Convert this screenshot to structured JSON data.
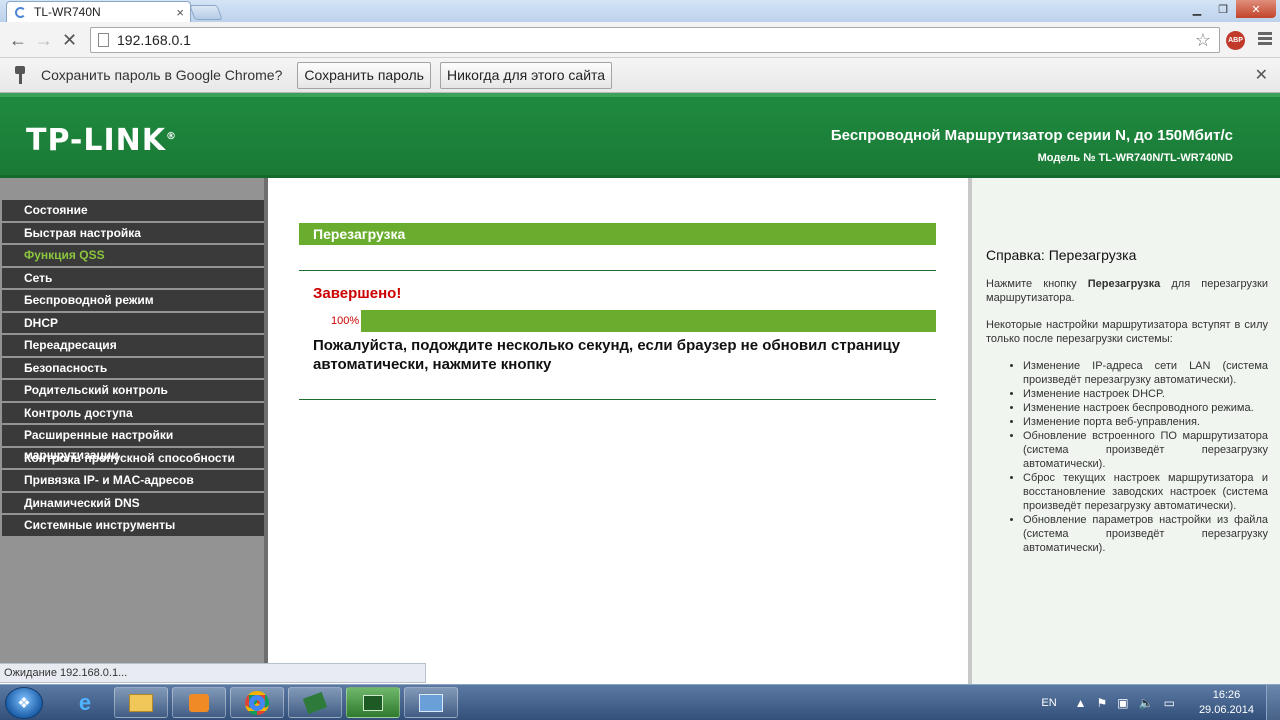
{
  "browser": {
    "tab_title": "TL-WR740N",
    "address": "192.168.0.1",
    "window_controls": {
      "minimize": "▁",
      "maximize": "❐",
      "close": "✕"
    }
  },
  "infobar": {
    "message": "Сохранить пароль в Google Chrome?",
    "save_label": "Сохранить пароль",
    "never_label": "Никогда для этого сайта"
  },
  "router": {
    "logo": "TP-LINK",
    "title": "Беспроводной Маршрутизатор серии N, до 150Мбит/с",
    "model": "Модель № TL-WR740N/TL-WR740ND"
  },
  "sidebar": {
    "items": [
      {
        "label": "Состояние"
      },
      {
        "label": "Быстрая настройка"
      },
      {
        "label": "Функция QSS"
      },
      {
        "label": "Сеть"
      },
      {
        "label": "Беспроводной режим"
      },
      {
        "label": "DHCP"
      },
      {
        "label": "Переадресация"
      },
      {
        "label": "Безопасность"
      },
      {
        "label": "Родительский контроль"
      },
      {
        "label": "Контроль доступа"
      },
      {
        "label": "Расширенные настройки маршрутизации"
      },
      {
        "label": "Контроль пропускной способности"
      },
      {
        "label": "Привязка IP- и MAC-адресов"
      },
      {
        "label": "Динамический DNS"
      },
      {
        "label": "Системные инструменты"
      }
    ],
    "active_index": 2
  },
  "main": {
    "section_title": "Перезагрузка",
    "status": "Завершено!",
    "progress_label": "100%",
    "progress_value": 100,
    "message": "Пожалуйста, подождите несколько секунд, если браузер не обновил страницу автоматически, нажмите кнопку"
  },
  "help": {
    "title": "Справка: Перезагрузка",
    "intro_prefix": "Нажмите кнопку ",
    "intro_bold": "Перезагрузка",
    "intro_suffix": " для перезагрузки маршрутизатора.",
    "note": "Некоторые настройки маршрутизатора вступят в силу только после перезагрузки системы:",
    "items": [
      "Изменение IP-адреса сети LAN (система произведёт перезагрузку автоматически).",
      "Изменение настроек DHCP.",
      "Изменение настроек беспроводного режима.",
      "Изменение порта веб-управления.",
      "Обновление встроенного ПО маршрутизатора (система произведёт перезагрузку автоматически).",
      "Сброс текущих настроек маршрутизатора и восстановление заводских настроек (система произведёт перезагрузку автоматически).",
      "Обновление параметров настройки из файла (система произведёт перезагрузку автоматически)."
    ]
  },
  "statusbar": {
    "text": "Ожидание 192.168.0.1..."
  },
  "taskbar": {
    "language": "EN",
    "time": "16:26",
    "date": "29.06.2014"
  },
  "colors": {
    "tplink_green": "#1f8a3f",
    "progress_green": "#6aad2e",
    "active_menu": "#8bc53f",
    "error_red": "#cc0000"
  }
}
